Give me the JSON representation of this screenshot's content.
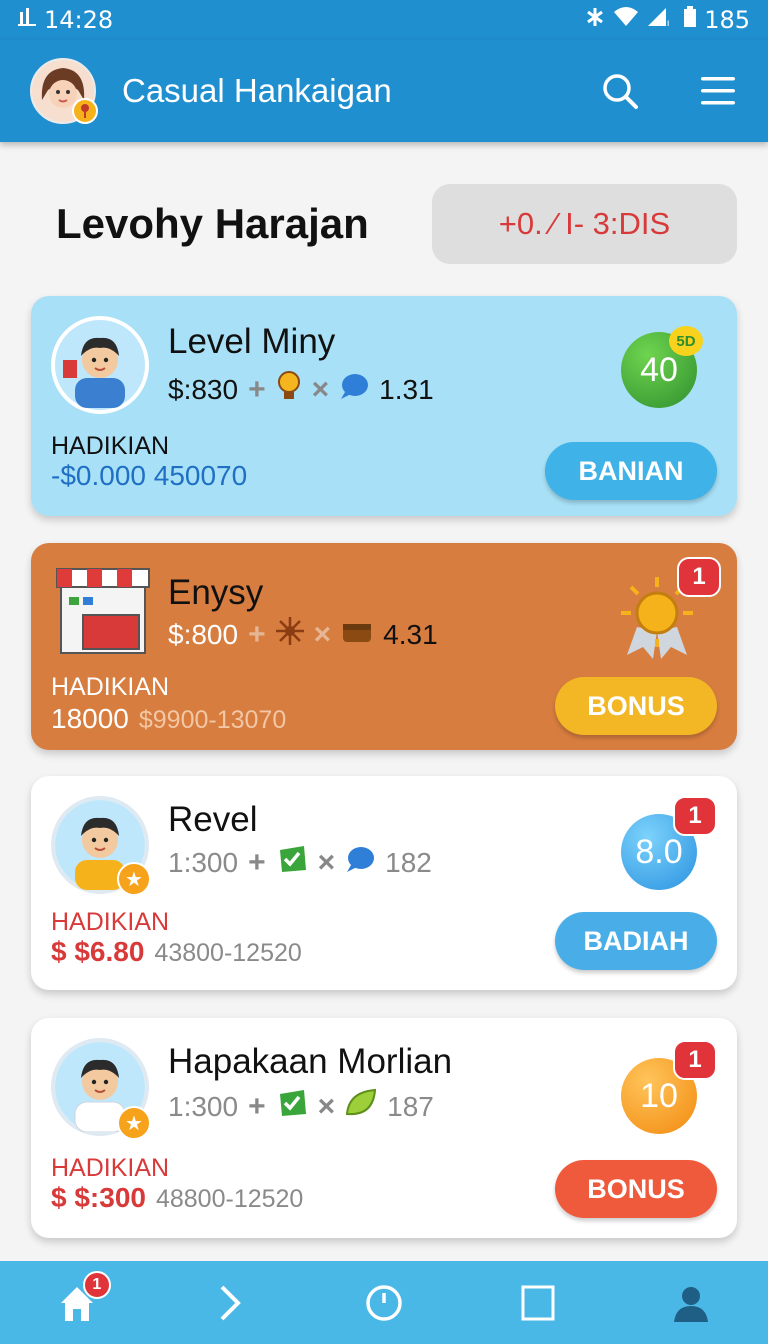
{
  "status_bar": {
    "time": "14:28",
    "battery": "185"
  },
  "header": {
    "title": "Casual Hankaigan"
  },
  "section": {
    "title": "Levohy Harajan",
    "status": "+0. ⁄ I- 3:DIS"
  },
  "cards": [
    {
      "name": "Level Miny",
      "stat_primary": "$:830",
      "stat_secondary": "1.31",
      "label": "HADIKIAN",
      "value": "-$0.000 450070",
      "value_sub": "",
      "level": "40",
      "level_tag": "5D",
      "button": "BANIAN",
      "colors": {
        "bg": "#a8e1f7",
        "button": "#3fb2e8",
        "ball": "#3aa53a"
      }
    },
    {
      "name": "Enysy",
      "stat_primary": "$:800",
      "stat_secondary": "4.31",
      "label": "HADIKIAN",
      "value": "18000",
      "value_sub": "$9900-13070",
      "badge": "1",
      "button": "BONUS",
      "colors": {
        "bg": "#d77d3f",
        "button": "#f3b625"
      }
    },
    {
      "name": "Revel",
      "stat_primary": "1:300",
      "stat_secondary": "182",
      "label": "HADIKIAN",
      "value": "$ $6.80",
      "value_sub": "43800-12520",
      "badge": "1",
      "level": "8.0",
      "button": "BADIAH",
      "colors": {
        "bg": "#ffffff",
        "button": "#49aee8",
        "ball": "#3aa8ec"
      }
    },
    {
      "name": "Hapakaan Morlian",
      "stat_primary": "1:300",
      "stat_secondary": "187",
      "label": "HADIKIAN",
      "value": "$ $:300",
      "value_sub": "48800-12520",
      "badge": "1",
      "level": "10",
      "button": "BONUS",
      "colors": {
        "bg": "#ffffff",
        "button": "#f05a3c",
        "ball": "#f59a1c"
      }
    }
  ],
  "bottom_nav": {
    "home_badge": "1"
  }
}
